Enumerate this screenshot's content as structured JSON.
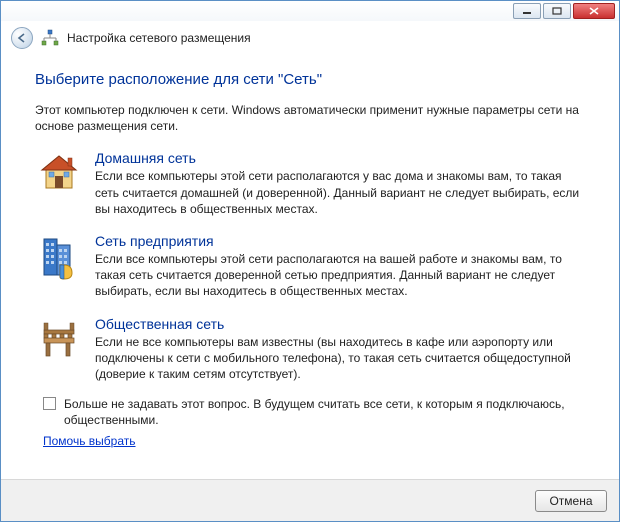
{
  "header": {
    "title": "Настройка сетевого размещения"
  },
  "main": {
    "heading": "Выберите расположение для сети \"Сеть\"",
    "intro": "Этот компьютер подключен к сети. Windows автоматически применит нужные параметры сети на основе размещения сети."
  },
  "options": {
    "home": {
      "title": "Домашняя сеть",
      "desc": "Если все компьютеры этой сети располагаются у вас дома и знакомы вам, то такая сеть считается домашней (и доверенной). Данный вариант не следует выбирать, если вы находитесь в общественных местах."
    },
    "work": {
      "title": "Сеть предприятия",
      "desc": "Если все компьютеры этой сети располагаются на вашей работе и знакомы вам, то такая сеть считается доверенной сетью предприятия. Данный вариант не следует выбирать, если вы находитесь в общественных местах."
    },
    "public": {
      "title": "Общественная сеть",
      "desc": "Если не все компьютеры вам известны (вы находитесь в кафе или аэропорту или подключены к сети с мобильного телефона), то такая сеть считается общедоступной (доверие к таким сетям отсутствует)."
    }
  },
  "checkbox": {
    "label": "Больше не задавать этот вопрос. В будущем считать все сети, к которым я подключаюсь, общественными."
  },
  "help_link": "Помочь выбрать",
  "footer": {
    "cancel": "Отмена"
  }
}
